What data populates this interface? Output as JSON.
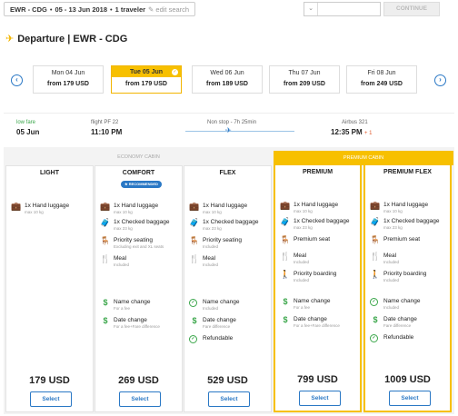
{
  "search": {
    "route": "EWR - CDG",
    "dates": "05 - 13 Jun 2018",
    "travelers": "1 traveler",
    "edit": "edit search"
  },
  "continue_label": "CONTINUE",
  "departure_title": "Departure | EWR - CDG",
  "dates": [
    {
      "day": "Mon 04 Jun",
      "price": "from 179 USD"
    },
    {
      "day": "Tue 05 Jun",
      "price": "from 179 USD"
    },
    {
      "day": "Wed 06 Jun",
      "price": "from 189 USD"
    },
    {
      "day": "Thu 07 Jun",
      "price": "from 209 USD"
    },
    {
      "day": "Fri 08 Jun",
      "price": "from 249 USD"
    }
  ],
  "flight": {
    "low_fare": "low fare",
    "date": "05 Jun",
    "flight_no": "flight PF 22",
    "dep_time": "11:10 PM",
    "nonstop": "Non stop - 7h 25min",
    "aircraft": "Airbus 321",
    "arr_time": "12:35 PM",
    "plus_day": "+ 1"
  },
  "cabins": {
    "economy": "ECONOMY CABIN",
    "premium": "PREMIUM CABIN"
  },
  "columns": [
    {
      "name": "LIGHT",
      "price": "179 USD",
      "select": "Select",
      "features": {
        "hand_t": "1x Hand luggage",
        "hand_s": "max 10 kg"
      }
    },
    {
      "name": "COMFORT",
      "badge": "RECOMMENDED",
      "price": "269 USD",
      "select": "Select",
      "features": {
        "hand_t": "1x Hand luggage",
        "hand_s": "max 10 kg",
        "checked_t": "1x Checked baggage",
        "checked_s": "max 23 kg",
        "seat_t": "Priority seating",
        "seat_s": "Excluding exit and XL seats",
        "meal_t": "Meal",
        "meal_s": "Included",
        "name_t": "Name change",
        "name_s": "For a fee",
        "date_t": "Date change",
        "date_s": "For a fee+Fare difference"
      }
    },
    {
      "name": "FLEX",
      "price": "529 USD",
      "select": "Select",
      "features": {
        "hand_t": "1x Hand luggage",
        "hand_s": "max 10 kg",
        "checked_t": "1x Checked baggage",
        "checked_s": "max 23 kg",
        "seat_t": "Priority seating",
        "seat_s": "Included",
        "meal_t": "Meal",
        "meal_s": "Included",
        "name_t": "Name change",
        "name_s": "Included",
        "date_t": "Date change",
        "date_s": "Fare difference",
        "refund_t": "Refundable"
      }
    },
    {
      "name": "PREMIUM",
      "price": "799 USD",
      "select": "Select",
      "features": {
        "hand_t": "1x Hand luggage",
        "hand_s": "max 10 kg",
        "checked_t": "1x Checked baggage",
        "checked_s": "max 23 kg",
        "seat_t": "Premium seat",
        "meal_t": "Meal",
        "meal_s": "Included",
        "board_t": "Priority boarding",
        "board_s": "Included",
        "name_t": "Name change",
        "name_s": "For a fee",
        "date_t": "Date change",
        "date_s": "For a fee+Fare difference"
      }
    },
    {
      "name": "PREMIUM FLEX",
      "price": "1009 USD",
      "select": "Select",
      "features": {
        "hand_t": "1x Hand luggage",
        "hand_s": "max 10 kg",
        "checked_t": "1x Checked baggage",
        "checked_s": "max 23 kg",
        "seat_t": "Premium seat",
        "meal_t": "Meal",
        "meal_s": "Included",
        "board_t": "Priority boarding",
        "board_s": "Included",
        "name_t": "Name change",
        "name_s": "Included",
        "date_t": "Date change",
        "date_s": "Fare difference",
        "refund_t": "Refundable"
      }
    }
  ],
  "colors": {
    "accent": "#f7c000",
    "link": "#2a78c5",
    "success": "#3aa64a"
  },
  "icons": [
    "chevron-left-icon",
    "chevron-right-icon",
    "plane-icon",
    "luggage-icon",
    "seat-icon",
    "meal-icon",
    "dollar-icon",
    "check-circle-icon"
  ]
}
